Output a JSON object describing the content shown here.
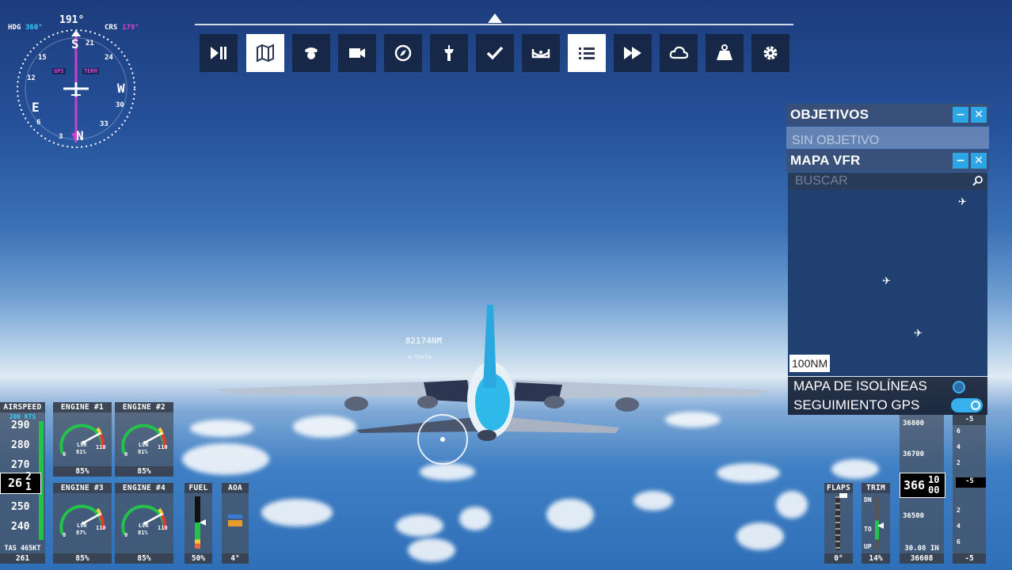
{
  "compass": {
    "heading": "191°",
    "hdg_label": "HDG",
    "hdg_value": "360°",
    "crs_label": "CRS",
    "crs_value": "179°",
    "gps_label": "GPS",
    "ete_label": "TERM",
    "marks": [
      "S",
      "W",
      "N",
      "E",
      "3",
      "6",
      "12",
      "15",
      "21",
      "24",
      "30",
      "33"
    ]
  },
  "toolbar": {
    "buttons": [
      {
        "name": "pause",
        "active": false
      },
      {
        "name": "vfr-map",
        "active": true
      },
      {
        "name": "pilot",
        "active": false
      },
      {
        "name": "camera",
        "active": false
      },
      {
        "name": "navlog",
        "active": false
      },
      {
        "name": "atc",
        "active": false
      },
      {
        "name": "checklist",
        "active": false
      },
      {
        "name": "controls",
        "active": false
      },
      {
        "name": "objectives",
        "active": true
      },
      {
        "name": "sim-rate",
        "active": false
      },
      {
        "name": "weather",
        "active": false
      },
      {
        "name": "weight",
        "active": false
      },
      {
        "name": "settings",
        "active": false
      }
    ]
  },
  "objectives_panel": {
    "title": "OBJETIVOS",
    "empty_text": "SIN OBJETIVO"
  },
  "vfr_panel": {
    "title": "MAPA VFR",
    "search_placeholder": "BUSCAR",
    "scale": "100NM",
    "isolines_label": "MAPA DE ISOLÍNEAS",
    "gps_follow_label": "SEGUIMIENTO GPS",
    "isolines_on": false,
    "gps_follow_on": true
  },
  "waypoint": {
    "distance": "82174NM",
    "name": "e-Tesla"
  },
  "airspeed": {
    "title": "AIRSPEED",
    "bug": "200 KTS",
    "ticks": [
      "290",
      "280",
      "270",
      "250",
      "240"
    ],
    "current_left": "26",
    "current_right": [
      "2",
      "1"
    ],
    "tas_label": "TAS 465KT",
    "bottom": "261"
  },
  "engines": [
    {
      "title": "ENGINE #1",
      "lvr": "LVR",
      "pct": "81%",
      "value": "85%",
      "min": "0",
      "max": "110"
    },
    {
      "title": "ENGINE #2",
      "lvr": "LVR",
      "pct": "81%",
      "value": "85%",
      "min": "0",
      "max": "110"
    },
    {
      "title": "ENGINE #3",
      "lvr": "LVR",
      "pct": "87%",
      "value": "85%",
      "min": "0",
      "max": "110"
    },
    {
      "title": "ENGINE #4",
      "lvr": "LVR",
      "pct": "81%",
      "value": "85%",
      "min": "0",
      "max": "110"
    }
  ],
  "fuel": {
    "title": "FUEL",
    "value": "50%",
    "level": 0.5
  },
  "aoa": {
    "title": "AOA",
    "value": "4°"
  },
  "flaps": {
    "title": "FLAPS",
    "value": "0°"
  },
  "trim": {
    "title": "TRIM",
    "dn": "DN",
    "to": "TO",
    "up": "UP",
    "value": "14%"
  },
  "altimeter": {
    "ticks": [
      "36800",
      "36700",
      "36600",
      "36500"
    ],
    "current_main": "366",
    "current_roll": [
      "10",
      "00"
    ],
    "baro": "30.08 IN",
    "bottom": "36608"
  },
  "vsi": {
    "ticks": [
      "6",
      "4",
      "2",
      "2",
      "4",
      "6"
    ],
    "top": "-5",
    "current": "-5",
    "bottom": "-5"
  }
}
